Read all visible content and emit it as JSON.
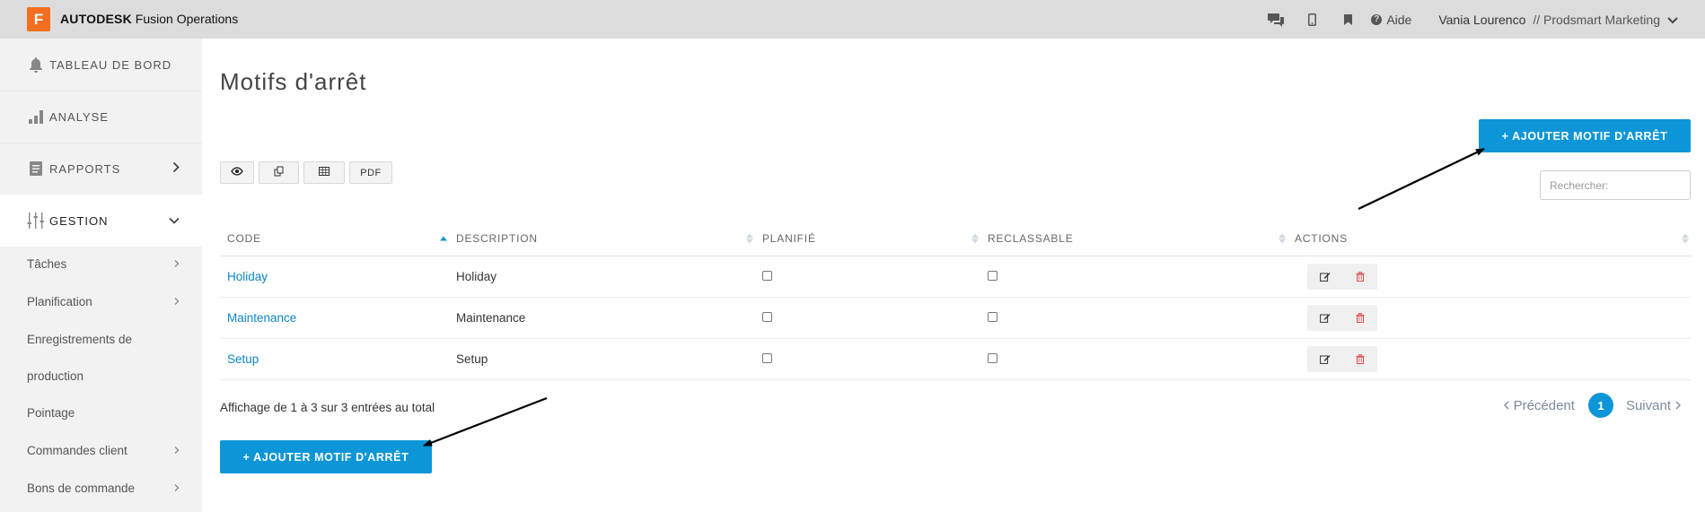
{
  "topbar": {
    "logo_letter": "F",
    "brand_bold": "AUTODESK",
    "brand_rest": "Fusion Operations",
    "help_label": "Aide",
    "user_name": "Vania Lourenco",
    "user_org": "// Prodsmart Marketing",
    "icons": [
      "chat-icon",
      "mobile-icon",
      "bookmark-icon",
      "help-icon",
      "chevron-down-icon"
    ]
  },
  "sidebar": {
    "main": [
      {
        "label": "TABLEAU DE BORD",
        "icon": "bell-icon"
      },
      {
        "label": "ANALYSE",
        "icon": "bar-chart-icon"
      },
      {
        "label": "RAPPORTS",
        "icon": "document-icon"
      },
      {
        "label": "GESTION",
        "icon": "sliders-icon"
      }
    ],
    "sub": [
      {
        "label": "Tâches"
      },
      {
        "label": "Planification"
      },
      {
        "label": "Enregistrements de"
      },
      {
        "label": "production"
      },
      {
        "label": "Pointage"
      },
      {
        "label": "Commandes client"
      },
      {
        "label": "Bons de commande"
      }
    ]
  },
  "page": {
    "title": "Motifs d'arrêt",
    "add_button_label": "+ AJOUTER MOTIF D'ARRÊT",
    "pdf_label": "PDF",
    "search_placeholder": "Rechercher:"
  },
  "table": {
    "columns": [
      "CODE",
      "DESCRIPTION",
      "PLANIFIÉ",
      "RECLASSABLE",
      "ACTIONS"
    ],
    "rows": [
      {
        "code": "Holiday",
        "description": "Holiday",
        "planifie": false,
        "reclassable": false
      },
      {
        "code": "Maintenance",
        "description": "Maintenance",
        "planifie": false,
        "reclassable": false
      },
      {
        "code": "Setup",
        "description": "Setup",
        "planifie": false,
        "reclassable": false
      }
    ]
  },
  "footer": {
    "info": "Affichage de 1 à 3 sur 3 entrées au total",
    "prev": "Précédent",
    "current_page": "1",
    "next": "Suivant"
  },
  "colors": {
    "accent": "#0d96d7",
    "logo": "#f26f21",
    "delete": "#e04b4b"
  }
}
